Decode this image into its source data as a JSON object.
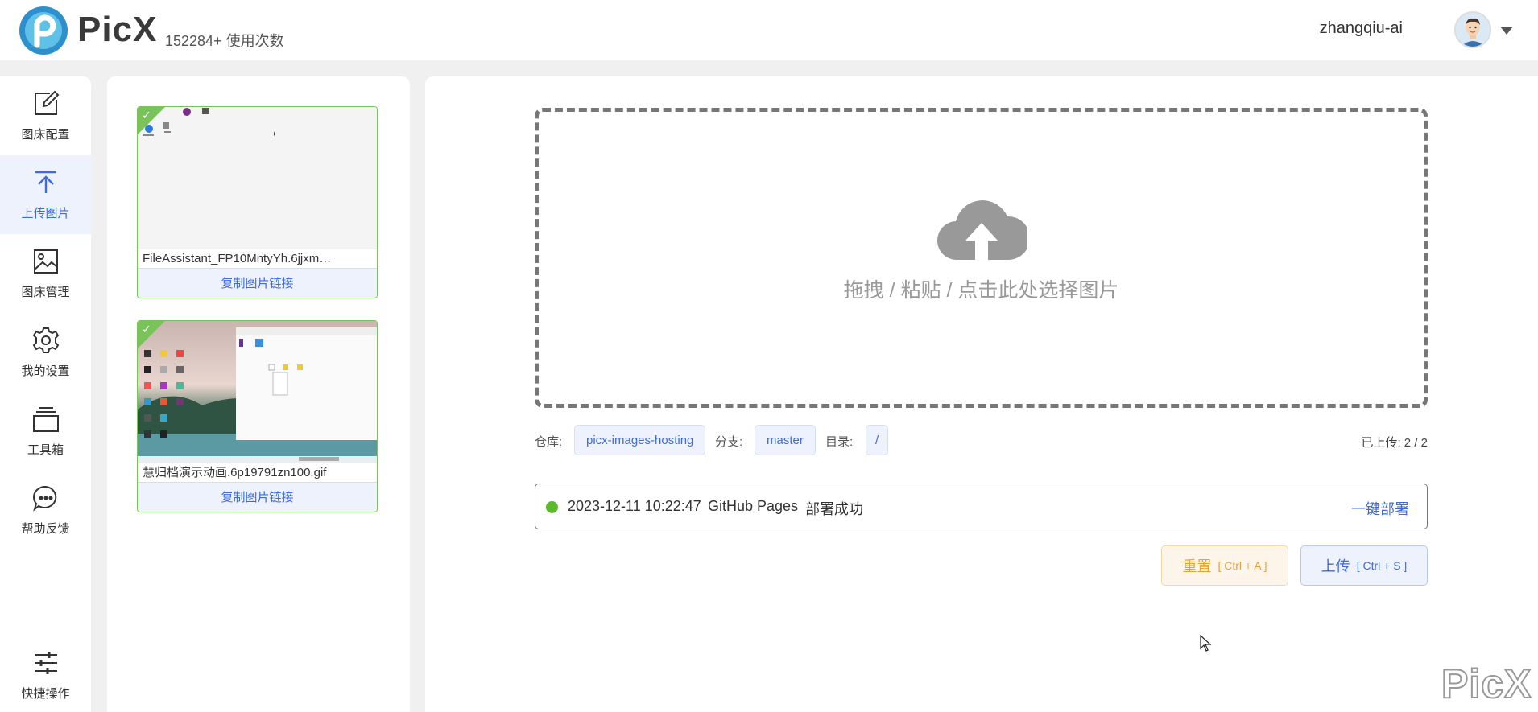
{
  "header": {
    "brand": "PicX",
    "usage": "152284+ 使用次数",
    "username": "zhangqiu-ai"
  },
  "sidebar": {
    "items": [
      {
        "label": "图床配置",
        "icon": "edit-icon"
      },
      {
        "label": "上传图片",
        "icon": "upload-icon",
        "active": true
      },
      {
        "label": "图床管理",
        "icon": "image-icon"
      },
      {
        "label": "我的设置",
        "icon": "gear-icon"
      },
      {
        "label": "工具箱",
        "icon": "toolbox-icon"
      },
      {
        "label": "帮助反馈",
        "icon": "chat-icon"
      }
    ],
    "bottom": {
      "label": "快捷操作",
      "icon": "sliders-icon"
    }
  },
  "images": [
    {
      "name": "FileAssistant_FP10MntyYh.6jjxm…",
      "copy_label": "复制图片链接"
    },
    {
      "name": "慧归档演示动画.6p19791zn100.gif",
      "copy_label": "复制图片链接"
    }
  ],
  "upload": {
    "drop_text": "拖拽 / 粘贴 / 点击此处选择图片",
    "repo_label": "仓库:",
    "repo": "picx-images-hosting",
    "branch_label": "分支:",
    "branch": "master",
    "dir_label": "目录:",
    "dir": "/",
    "uploaded": "已上传: 2 / 2"
  },
  "deploy": {
    "time": "2023-12-11 10:22:47",
    "target": "GitHub Pages",
    "status": "部署成功",
    "action": "一键部署"
  },
  "buttons": {
    "reset": "重置",
    "reset_shortcut": "[ Ctrl + A ]",
    "upload": "上传",
    "upload_shortcut": "[ Ctrl + S ]"
  },
  "watermark": "PicX",
  "colors": {
    "accent": "#3f6bd9",
    "success": "#5cb82c",
    "warning": "#e6a23c"
  }
}
